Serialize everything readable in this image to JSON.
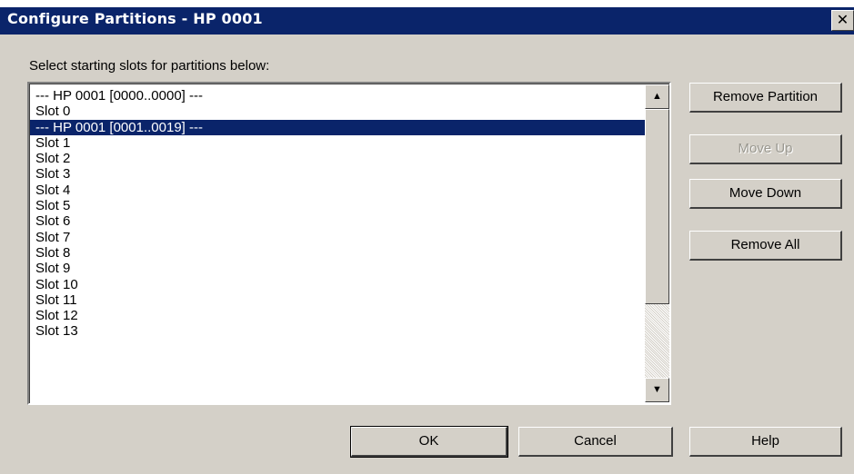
{
  "window": {
    "title": "Configure Partitions - HP 0001",
    "close_label": "✕"
  },
  "dialog": {
    "prompt": "Select starting slots for partitions below:"
  },
  "listbox": {
    "items": [
      {
        "label": "--- HP 0001 [0000..0000] ---",
        "selected": false
      },
      {
        "label": "Slot 0",
        "selected": false
      },
      {
        "label": "--- HP 0001 [0001..0019] ---",
        "selected": true
      },
      {
        "label": "Slot 1",
        "selected": false
      },
      {
        "label": "Slot 2",
        "selected": false
      },
      {
        "label": "Slot 3",
        "selected": false
      },
      {
        "label": "Slot 4",
        "selected": false
      },
      {
        "label": "Slot 5",
        "selected": false
      },
      {
        "label": "Slot 6",
        "selected": false
      },
      {
        "label": "Slot 7",
        "selected": false
      },
      {
        "label": "Slot 8",
        "selected": false
      },
      {
        "label": "Slot 9",
        "selected": false
      },
      {
        "label": "Slot 10",
        "selected": false
      },
      {
        "label": "Slot 11",
        "selected": false
      },
      {
        "label": "Slot 12",
        "selected": false
      },
      {
        "label": "Slot 13",
        "selected": false
      }
    ],
    "scroll_up_glyph": "▲",
    "scroll_down_glyph": "▼"
  },
  "buttons": {
    "remove_partition": "Remove Partition",
    "move_up": "Move Up",
    "move_down": "Move Down",
    "remove_all": "Remove All",
    "ok": "OK",
    "cancel": "Cancel",
    "help": "Help"
  },
  "colors": {
    "titlebar": "#0a246a",
    "selection": "#0a246a",
    "face": "#d4d0c8"
  }
}
